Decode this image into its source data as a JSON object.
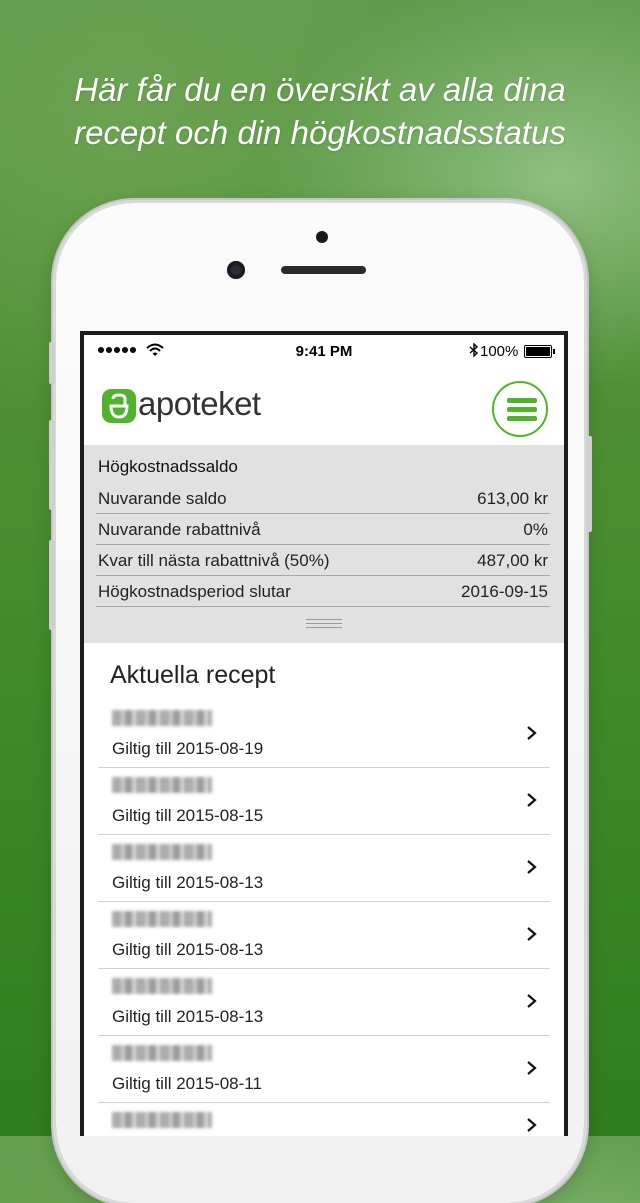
{
  "promo": {
    "line1": "Här får du en översikt av alla dina",
    "line2": "recept och din högkostnadsstatus"
  },
  "statusbar": {
    "time": "9:41 PM",
    "battery": "100%"
  },
  "app": {
    "logo_text": "apoteket",
    "brand_color": "#4fb32c"
  },
  "saldo": {
    "title": "Högkostnadssaldo",
    "rows": [
      {
        "label": "Nuvarande saldo",
        "value": "613,00 kr"
      },
      {
        "label": "Nuvarande rabattnivå",
        "value": "0%"
      },
      {
        "label": "Kvar till nästa rabattnivå (50%)",
        "value": "487,00 kr"
      },
      {
        "label": "Högkostnadsperiod slutar",
        "value": "2016-09-15"
      }
    ]
  },
  "recept": {
    "title": "Aktuella recept",
    "items": [
      {
        "valid": "Giltig till 2015-08-19"
      },
      {
        "valid": "Giltig till 2015-08-15"
      },
      {
        "valid": "Giltig till 2015-08-13"
      },
      {
        "valid": "Giltig till 2015-08-13"
      },
      {
        "valid": "Giltig till 2015-08-13"
      },
      {
        "valid": "Giltig till 2015-08-11"
      }
    ]
  }
}
